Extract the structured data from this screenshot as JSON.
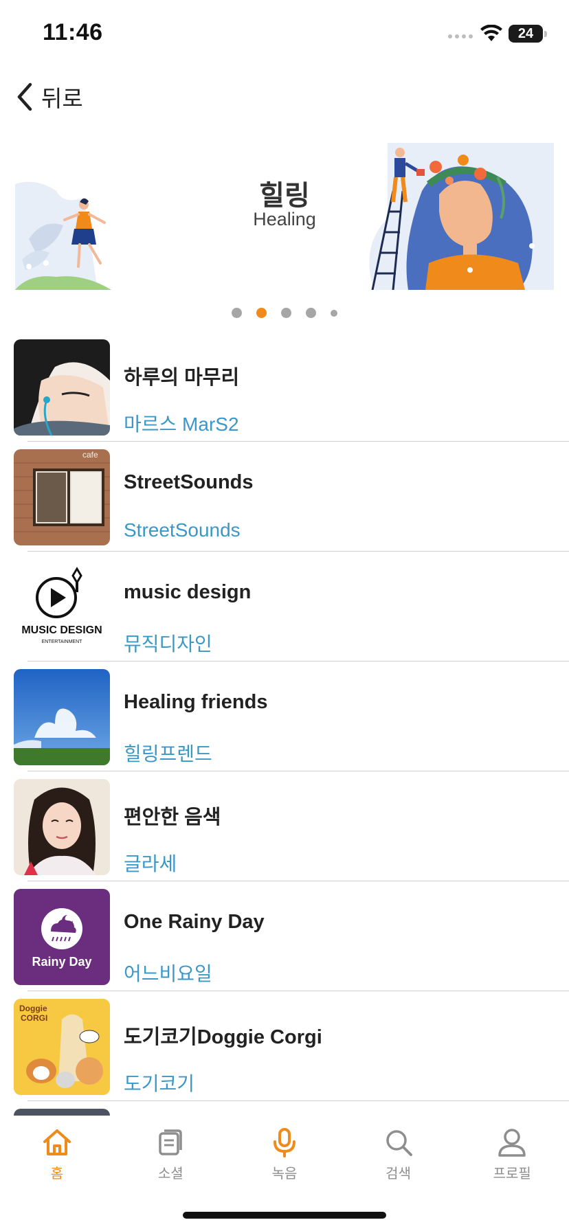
{
  "status": {
    "time": "11:46",
    "battery": "24"
  },
  "nav": {
    "back_label": "뒤로"
  },
  "banner": {
    "title": "힐링",
    "subtitle": "Healing"
  },
  "pager": {
    "count": 5,
    "active": 2
  },
  "list": [
    {
      "title": "하루의 마무리",
      "artist": "마르스 MarS2",
      "thumb": "anime-boy-earphones-thumb"
    },
    {
      "title": "StreetSounds",
      "artist": "StreetSounds",
      "thumb": "cafe-storefront-thumb"
    },
    {
      "title": "music design",
      "artist": "뮤직디자인",
      "thumb": "music-design-logo-thumb",
      "logo_text": "MUSIC DESIGN",
      "logo_sub": "ENTERTAINMENT"
    },
    {
      "title": "Healing friends",
      "artist": "힐링프렌드",
      "thumb": "blue-sky-field-thumb"
    },
    {
      "title": "편안한 음색",
      "artist": "글라세",
      "thumb": "woman-portrait-thumb"
    },
    {
      "title": "One Rainy Day",
      "artist": "어느비요일",
      "thumb": "rainy-day-logo-thumb",
      "logo_text": "Rainy Day"
    },
    {
      "title": "도기코기Doggie Corgi",
      "artist": "도기코기",
      "thumb": "doggie-corgi-thumb",
      "logo_text": "Doggie\nCORGI"
    }
  ],
  "tabs": [
    {
      "label": "홈",
      "icon": "home-icon",
      "active": true
    },
    {
      "label": "소셜",
      "icon": "social-icon",
      "active": false
    },
    {
      "label": "녹음",
      "icon": "mic-icon",
      "active": false
    },
    {
      "label": "검색",
      "icon": "search-icon",
      "active": false
    },
    {
      "label": "프로필",
      "icon": "profile-icon",
      "active": false
    }
  ],
  "colors": {
    "accent": "#f08a1a",
    "artist": "#3a98c8",
    "inactive": "#8e8e8e"
  }
}
